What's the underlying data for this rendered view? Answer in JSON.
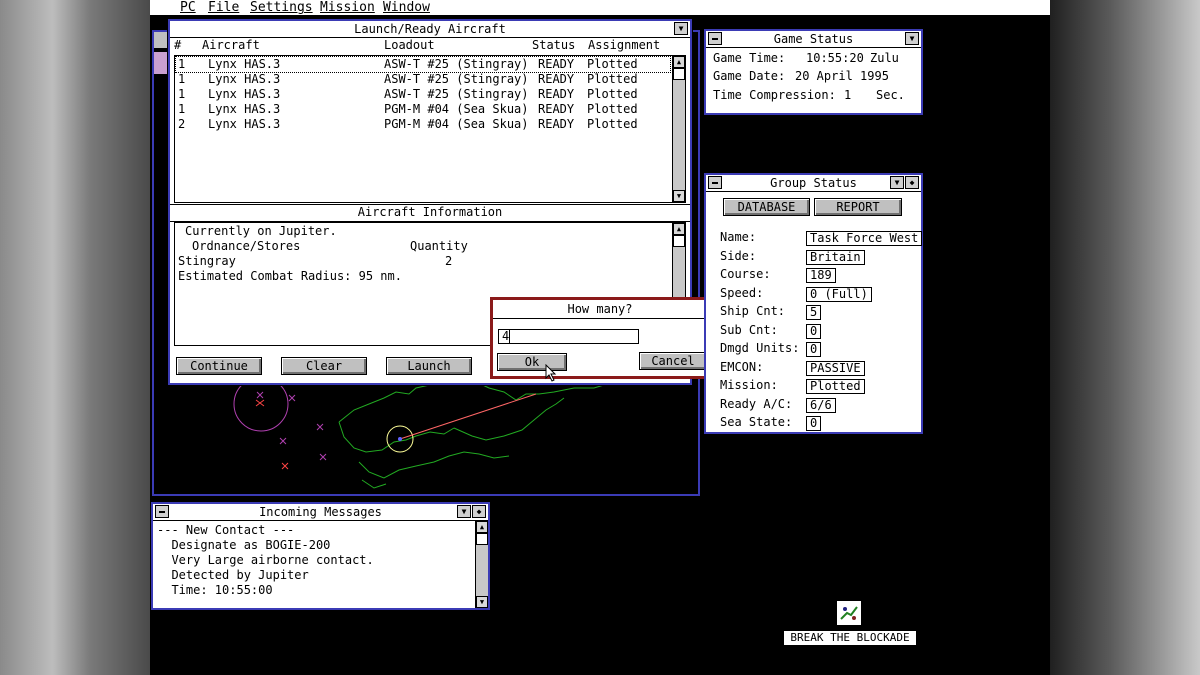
{
  "menubar": {
    "items": [
      "PC",
      "File",
      "Settings",
      "Mission",
      "Window"
    ]
  },
  "launch": {
    "title": "Launch/Ready Aircraft",
    "cols": [
      "#",
      "Aircraft",
      "Loadout",
      "Status",
      "Assignment"
    ],
    "rows": [
      {
        "n": "1",
        "aircraft": "Lynx HAS.3",
        "loadout": "ASW-T #25 (Stingray)",
        "status": "READY",
        "assign": "Plotted"
      },
      {
        "n": "1",
        "aircraft": "Lynx HAS.3",
        "loadout": "ASW-T #25 (Stingray)",
        "status": "READY",
        "assign": "Plotted"
      },
      {
        "n": "1",
        "aircraft": "Lynx HAS.3",
        "loadout": "ASW-T #25 (Stingray)",
        "status": "READY",
        "assign": "Plotted"
      },
      {
        "n": "1",
        "aircraft": "Lynx HAS.3",
        "loadout": "PGM-M #04 (Sea Skua)",
        "status": "READY",
        "assign": "Plotted"
      },
      {
        "n": "2",
        "aircraft": "Lynx HAS.3",
        "loadout": "PGM-M #04 (Sea Skua)",
        "status": "READY",
        "assign": "Plotted"
      }
    ],
    "info_title": "Aircraft Information",
    "info": {
      "location": "Currently on Jupiter.",
      "ord_header": "Ordnance/Stores",
      "qty_header": "Quantity",
      "item": "Stingray",
      "item_qty": "2",
      "radius": "Estimated Combat Radius: 95 nm."
    },
    "buttons": {
      "continue": "Continue",
      "clear": "Clear",
      "launch": "Launch"
    }
  },
  "dialog": {
    "title": "How many?",
    "value": "4",
    "ok": "Ok",
    "cancel": "Cancel"
  },
  "game_status": {
    "title": "Game Status",
    "time_label": "Game Time:",
    "time": "10:55:20",
    "zone": "Zulu",
    "date_label": "Game Date:",
    "date": "20 April 1995",
    "comp_label": "Time Compression:",
    "comp": "1",
    "comp_unit": "Sec."
  },
  "group_status": {
    "title": "Group Status",
    "database": "DATABASE",
    "report": "REPORT",
    "fields": [
      {
        "label": "Name:",
        "value": "Task Force West"
      },
      {
        "label": "Side:",
        "value": "Britain"
      },
      {
        "label": "Course:",
        "value": "189"
      },
      {
        "label": "Speed:",
        "value": "0 (Full)"
      },
      {
        "label": "Ship Cnt:",
        "value": "5"
      },
      {
        "label": "Sub Cnt:",
        "value": "0"
      },
      {
        "label": "Dmgd Units:",
        "value": "0"
      },
      {
        "label": "EMCON:",
        "value": "PASSIVE"
      },
      {
        "label": "Mission:",
        "value": "Plotted"
      },
      {
        "label": "Ready A/C:",
        "value": "6/6"
      },
      {
        "label": "Sea State:",
        "value": "0"
      }
    ]
  },
  "messages": {
    "title": "Incoming Messages",
    "lines": [
      "--- New Contact ---",
      "  Designate as BOGIE-200",
      "  Very Large airborne contact.",
      "  Detected by Jupiter",
      "  Time: 10:55:00"
    ]
  },
  "desktop_icon": {
    "label": "BREAK THE BLOCKADE"
  },
  "colors": {
    "frame": "#3b3bb5",
    "dialog_border": "#8b1a1a",
    "coast": "#22aa22",
    "track": "#ff6666"
  }
}
